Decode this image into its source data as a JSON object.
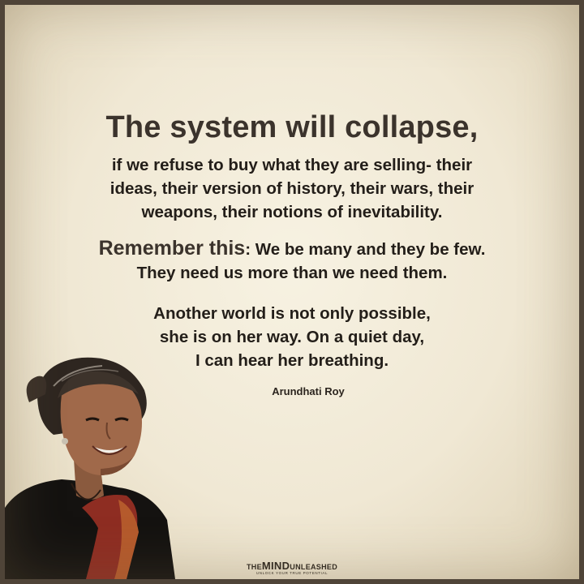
{
  "quote": {
    "title": "The system will collapse,",
    "paragraph1": [
      "if we refuse to buy what they are selling- their",
      "ideas, their version of history, their wars, their",
      "weapons, their notions of inevitability."
    ],
    "remember_label": "Remember this",
    "remember_rest": ": We be many and they be few.",
    "paragraph2_line2": "They need us more than we need them.",
    "paragraph3": [
      "Another world is not only possible,",
      "she is on her way. On a quiet day,",
      "I can hear her breathing."
    ],
    "author": "Arundhati Roy"
  },
  "logo": {
    "prefix": "THE",
    "brand": "MIND",
    "suffix": "UNLEASHED",
    "tagline": "UNLOCK YOUR TRUE POTENTIAL"
  },
  "colors": {
    "background": "#f1ebd8",
    "frame": "#4f4438",
    "title_text": "#3b332c",
    "body_text": "#231e19"
  },
  "icons": [
    "portrait-photo"
  ]
}
